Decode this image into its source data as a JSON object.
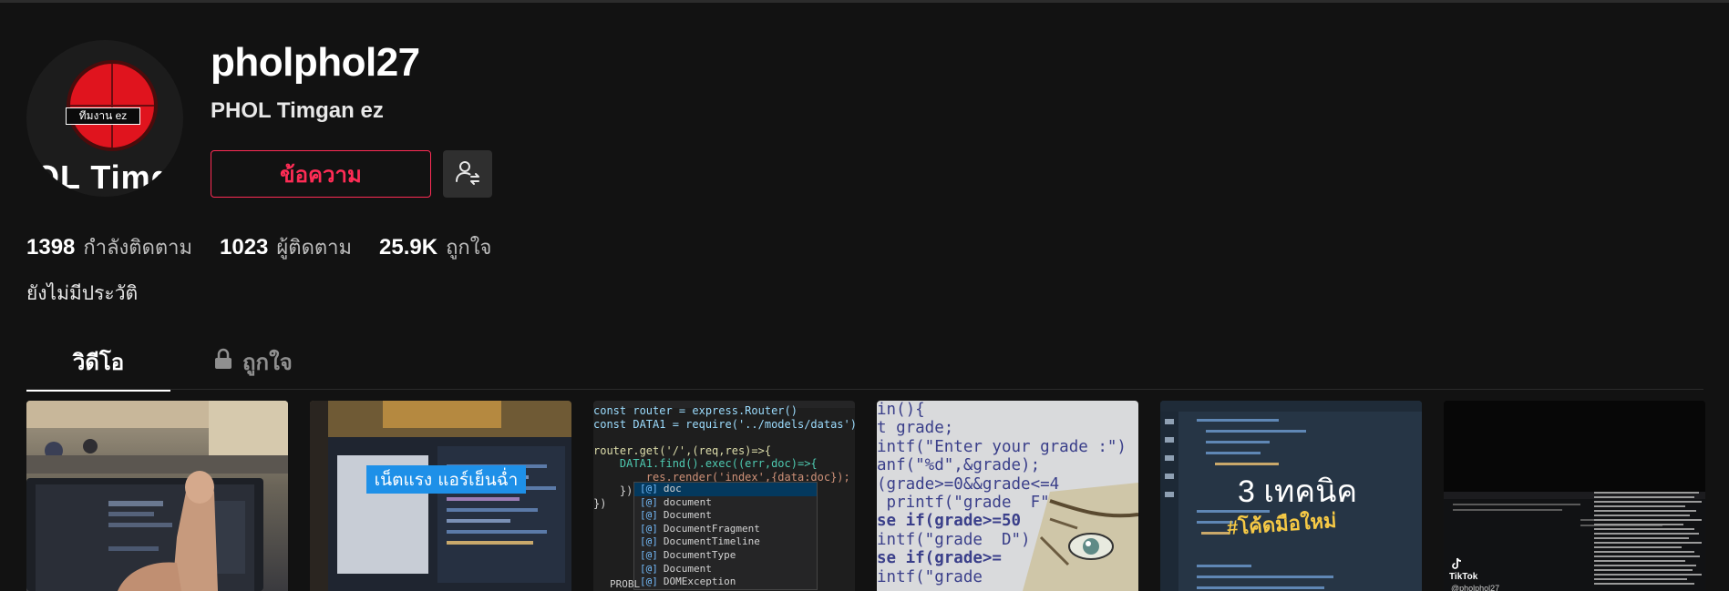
{
  "profile": {
    "username": "pholphol27",
    "nickname": "PHOL Timgan ez",
    "avatar_badge": "ทีมงาน ez",
    "avatar_text": "OL Timga",
    "message_button": "ข้อความ",
    "follow_icon": "user-swap-icon"
  },
  "stats": {
    "following": {
      "value": "1398",
      "label": "กำลังติดตาม"
    },
    "followers": {
      "value": "1023",
      "label": "ผู้ติดตาม"
    },
    "likes": {
      "value": "25.9K",
      "label": "ถูกใจ"
    }
  },
  "bio": "ยังไม่มีประวัติ",
  "tabs": {
    "videos": "วิดีโอ",
    "liked": "ถูกใจ",
    "liked_icon": "lock-icon"
  },
  "videos": {
    "v2_caption": "เน็ตแรง แอร์เย็นฉ่ำ",
    "v3_code": [
      "const router = express.Router()",
      "const DATA1 = require('../models/datas')",
      "",
      "router.get('/',(req,res)=>{",
      "    DATA1.find().exec((err,doc)=>{",
      "        res.render('index',{data:doc});",
      "    })",
      "})"
    ],
    "v3_suggestions": [
      "doc",
      "document",
      "Document",
      "DocumentFragment",
      "DocumentTimeline",
      "DocumentType",
      "Document",
      "DOMException"
    ],
    "v3_problems": "PROBL",
    "v4_code": [
      "in(){",
      "t grade;",
      "intf(\"Enter your grade :\")",
      "anf(\"%d\",&grade);",
      "(grade>=0&&grade<=4",
      " printf(\"grade  F\"",
      "se if(grade>=50",
      "intf(\"grade  D\")",
      "se if(grade>=",
      "intf(\"grade"
    ],
    "v5_title": "3 เทคนิค",
    "v5_subtitle": "#โค้ดมือใหม่",
    "v6_brand": "TikTok",
    "v6_handle": "@pholphol27"
  },
  "colors": {
    "background": "#121212",
    "accent": "#fe2c55",
    "muted": "#8f8f8f"
  }
}
